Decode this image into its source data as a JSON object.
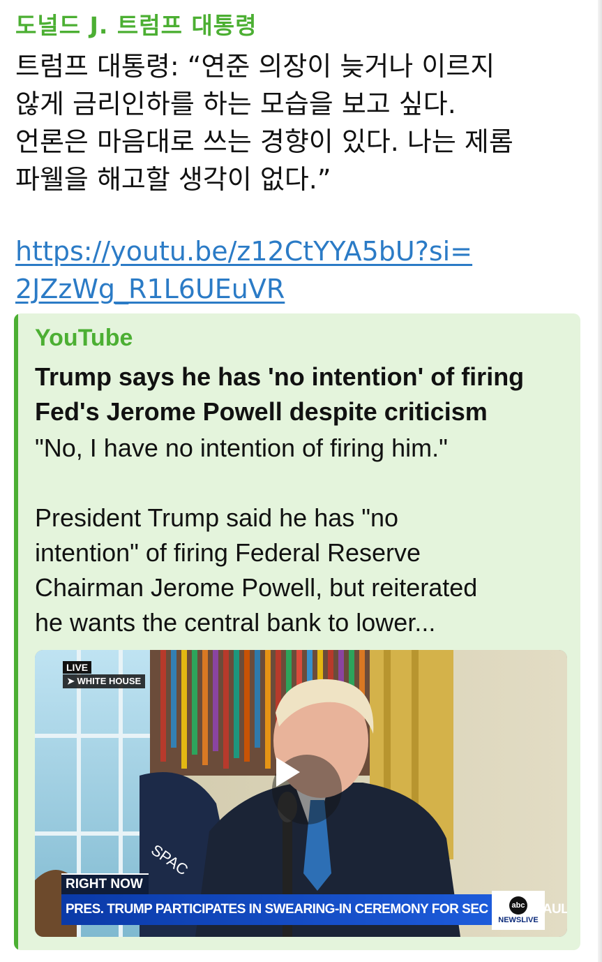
{
  "message": {
    "sender": "도널드 J. 트럼프 대통령",
    "lines": [
      "트럼프 대통령: “연준 의장이 늦거나 이르지",
      "않게 금리인하를 하는 모습을 보고 싶다.",
      "언론은 마음대로 쓰는 경향이 있다. 나는 제롬",
      "파웰을 해고할 생각이 없다.”"
    ],
    "link_lines": [
      "https://youtu.be/z12CtYYA5bU?si=",
      "2JZzWg_R1L6UEuVR"
    ]
  },
  "preview": {
    "site": "YouTube",
    "title_lines": [
      "Trump says he has 'no intention' of firing",
      "Fed's Jerome Powell despite criticism"
    ],
    "desc_line1": "\"No, I have no intention of firing him.\"",
    "desc_lines": [
      "President Trump said he has \"no",
      "intention\" of firing Federal Reserve",
      "Chairman Jerome Powell, but reiterated",
      "he wants the central bank to lower..."
    ],
    "video": {
      "live_badge": "LIVE",
      "location_badge": "➤ WHITE HOUSE",
      "right_now": "RIGHT NOW",
      "ticker": "PRES. TRUMP PARTICIPATES IN SWEARING-IN CEREMONY FOR SEC CHAIR PAUL ATKINS",
      "network_logo": "abc",
      "network_name": "NEWSLIVE",
      "play_icon": "play-icon"
    }
  },
  "colors": {
    "accent": "#4caf33",
    "link": "#2b7bc6",
    "preview_bg": "#e4f4dc",
    "ticker": "#0a3aa8"
  }
}
